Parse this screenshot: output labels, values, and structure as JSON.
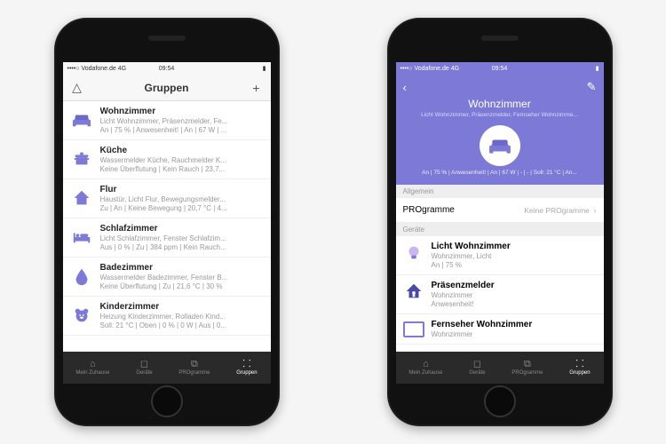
{
  "statusbar": {
    "carrier": "••••○ Vodafone.de",
    "network": "4G",
    "time": "09:54"
  },
  "phone1": {
    "nav": {
      "title": "Gruppen",
      "left_icon": "△",
      "right_icon": "+"
    },
    "groups": [
      {
        "icon": "sofa",
        "title": "Wohnzimmer",
        "subtitle": "Licht Wohnzimmer, Präsenzmelder, Fe...",
        "status": "An | 75 % | Anwesenheit! | An | 67 W | ..."
      },
      {
        "icon": "pot",
        "title": "Küche",
        "subtitle": "Wassermelder Küche, Rauchmelder K...",
        "status": "Keine Überflutung | Kein Rauch | 23,7..."
      },
      {
        "icon": "house",
        "title": "Flur",
        "subtitle": "Haustür, Licht Flur, Bewegungsmelder...",
        "status": "Zu | An | Keine Bewegung | 20,7 °C | 4..."
      },
      {
        "icon": "bed",
        "title": "Schlafzimmer",
        "subtitle": "Licht Schlafzimmer, Fenster Schlafzim...",
        "status": "Aus | 0 % | Zu | 384 ppm | Kein Rauch..."
      },
      {
        "icon": "drop",
        "title": "Badezimmer",
        "subtitle": "Wassermelder Badezimmer, Fenster B...",
        "status": "Keine Überflutung | Zu | 21,6 °C | 30 %"
      },
      {
        "icon": "bear",
        "title": "Kinderzimmer",
        "subtitle": "Heizung Kinderzimmer, Rolladen Kind...",
        "status": "Soll: 21 °C | Oben | 0 % | 0 W | Aus | 0..."
      }
    ]
  },
  "phone2": {
    "hero": {
      "title": "Wohnzimmer",
      "subtitle": "Licht Wohnzimmer, Präsenzmelder, Fernseher Wohnzimme...",
      "status": "An | 75 % | Anwesenheit! | An | 67 W | - | - | Soll: 21 °C | An..."
    },
    "section_allgemein": "Allgemein",
    "programs": {
      "label": "PROgramme",
      "value": "Keine PROgramme"
    },
    "section_geraete": "Geräte",
    "devices": [
      {
        "icon": "bulb",
        "title": "Licht Wohnzimmer",
        "subtitle": "Wohnzimmer, Licht",
        "status": "An | 75 %"
      },
      {
        "icon": "presence",
        "title": "Präsenzmelder",
        "subtitle": "Wohnzimmer",
        "status": "Anwesenheit!"
      },
      {
        "icon": "tv",
        "title": "Fernseher Wohnzimmer",
        "subtitle": "Wohnzimmer",
        "status": ""
      }
    ]
  },
  "tabs": [
    {
      "icon": "⌂",
      "label": "Mein Zuhause"
    },
    {
      "icon": "◻",
      "label": "Geräte"
    },
    {
      "icon": "⧉",
      "label": "PROgramme"
    },
    {
      "icon": "⸬",
      "label": "Gruppen"
    }
  ]
}
